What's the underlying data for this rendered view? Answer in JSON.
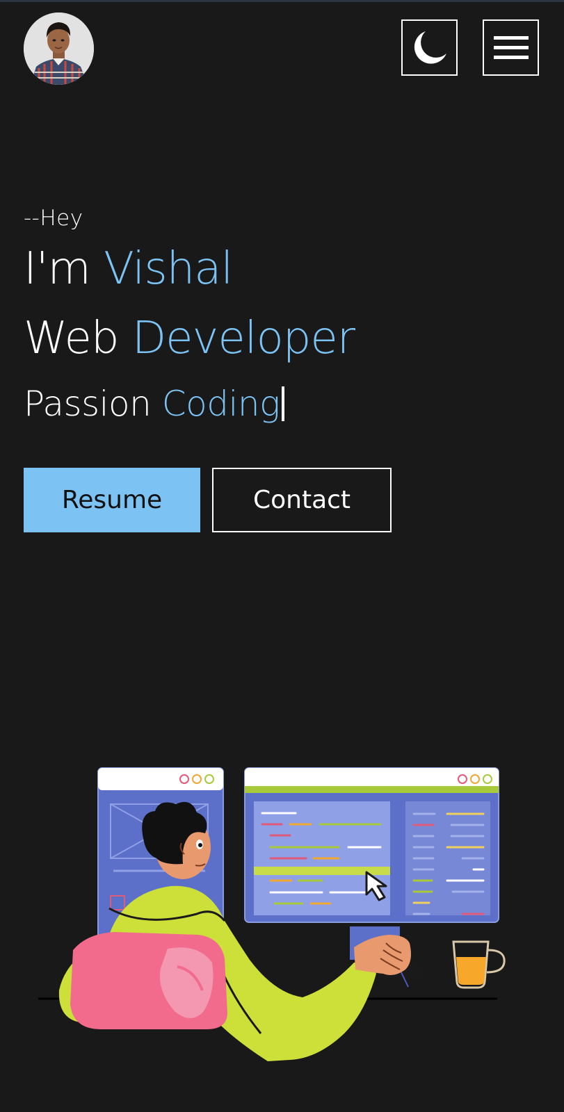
{
  "header": {
    "avatar_alt": "profile photo",
    "theme_icon": "moon-icon",
    "menu_icon": "hamburger-menu-icon"
  },
  "hero": {
    "greeting": "--Hey",
    "line1_prefix": "I'm ",
    "line1_accent": "Vishal",
    "line2_prefix": "Web ",
    "line2_accent": "Developer",
    "line3_prefix": "Passion ",
    "line3_accent": "Coding"
  },
  "actions": {
    "resume_label": "Resume",
    "contact_label": "Contact"
  },
  "colors": {
    "background": "#191919",
    "accent": "#7cc3f3",
    "text": "#ffffff"
  }
}
